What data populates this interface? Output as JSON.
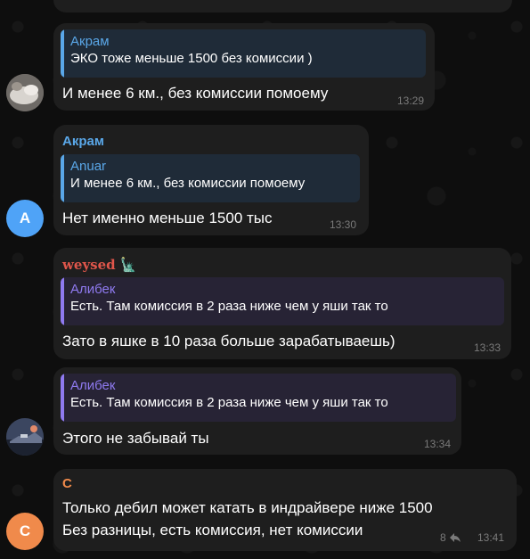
{
  "colors": {
    "background": "#0e0e0e",
    "bubble": "#1e1e1e",
    "sender_blue": "#5aa7e8",
    "sender_weysed": "#e0564b",
    "sender_c": "#f08a4b",
    "quote_purple": "#8f7af0",
    "time": "#7a7a7a"
  },
  "messages": [
    {
      "reply_to": {
        "author": "Акрам",
        "text": "ЭКО тоже меньше 1500 без комиссии )"
      },
      "text": "И менее 6 км., без комиссии помоему",
      "time": "13:29",
      "avatar": {
        "kind": "photo",
        "icon": "user-photo-icon"
      }
    },
    {
      "sender": "Акрам",
      "reply_to": {
        "author": "Anuar",
        "text": "И менее 6 км., без комиссии помоему"
      },
      "text": "Нет именно меньше 1500 тыс",
      "time": "13:30",
      "avatar": {
        "kind": "letter",
        "letter": "A",
        "color": "#4fa3f7"
      }
    },
    {
      "sender": "weysed",
      "sender_emoji": "🗽",
      "reply_to": {
        "author": "Алибек",
        "text": "Есть. Там комиссия в 2 раза ниже чем у яши так то"
      },
      "text": "Зато в яшке в 10 раза больше зарабатываешь)",
      "time": "13:33"
    },
    {
      "reply_to": {
        "author": "Алибек",
        "text": "Есть. Там комиссия в 2 раза ниже чем у яши так то"
      },
      "text": "Этого не забывай ты",
      "time": "13:34",
      "avatar": {
        "kind": "photo",
        "icon": "user-photo-icon"
      }
    },
    {
      "sender": "С",
      "lines": [
        "Только дебил может катать в индрайвере ниже 1500",
        "Без разницы, есть комиссия, нет комиссии"
      ],
      "reply_count": "8",
      "time": "13:41",
      "avatar": {
        "kind": "letter",
        "letter": "С",
        "color": "#f08a4b"
      }
    }
  ]
}
